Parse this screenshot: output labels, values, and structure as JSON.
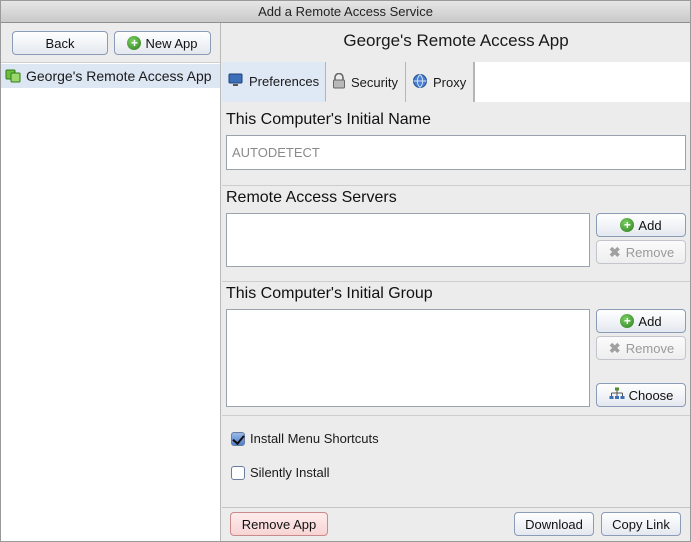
{
  "window": {
    "title": "Add a Remote Access Service"
  },
  "left": {
    "back_label": "Back",
    "new_app_label": "New App",
    "apps": [
      {
        "label": "George's Remote Access App"
      }
    ]
  },
  "main": {
    "app_title": "George's Remote Access App",
    "tabs": [
      {
        "label": "Preferences"
      },
      {
        "label": "Security"
      },
      {
        "label": "Proxy"
      }
    ],
    "initial_name": {
      "title": "This Computer's Initial Name",
      "value": "AUTODETECT"
    },
    "servers": {
      "title": "Remote Access Servers",
      "add_label": "Add",
      "remove_label": "Remove"
    },
    "group": {
      "title": "This Computer's Initial Group",
      "add_label": "Add",
      "remove_label": "Remove",
      "choose_label": "Choose"
    },
    "options": {
      "menu_shortcuts": "Install Menu Shortcuts",
      "silent_install": "Silently Install"
    },
    "footer": {
      "remove_app": "Remove App",
      "download": "Download",
      "copy_link": "Copy Link"
    }
  }
}
